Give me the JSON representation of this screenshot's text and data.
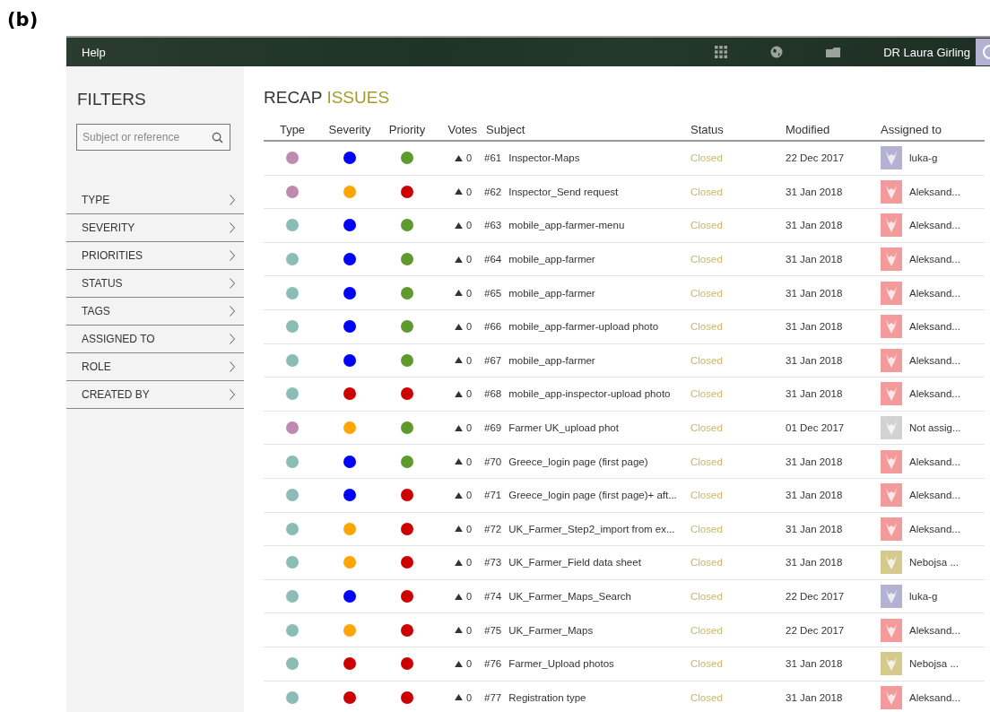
{
  "figure_label": "(b)",
  "topbar": {
    "help": "Help",
    "user": "DR Laura Girling"
  },
  "filters": {
    "title": "FILTERS",
    "search": {
      "placeholder": "Subject or reference"
    },
    "items": [
      "TYPE",
      "SEVERITY",
      "PRIORITIES",
      "STATUS",
      "TAGS",
      "ASSIGNED TO",
      "ROLE",
      "CREATED BY"
    ]
  },
  "page_title": {
    "first": "RECAP",
    "second": "ISSUES"
  },
  "table": {
    "columns": [
      "Type",
      "Severity",
      "Priority",
      "Votes",
      "Subject",
      "Status",
      "Modified",
      "Assigned to"
    ],
    "rows": [
      {
        "type": {
          "color": "#bf8aaf"
        },
        "severity": {
          "color": "#0000ff"
        },
        "priority": {
          "color": "#5f9a2f"
        },
        "votes": "0",
        "ref": "#61",
        "subject": "Inspector-Maps",
        "status": "Closed",
        "modified": "22 Dec 2017",
        "assignee": {
          "name": "luka-g",
          "color": "#b4b1d2"
        }
      },
      {
        "type": {
          "color": "#bf8aaf"
        },
        "severity": {
          "color": "#ffa500"
        },
        "priority": {
          "color": "#cc0000"
        },
        "votes": "0",
        "ref": "#62",
        "subject": "Inspector_Send request",
        "status": "Closed",
        "modified": "31 Jan 2018",
        "assignee": {
          "name": "Aleksand...",
          "color": "#f39b9b"
        }
      },
      {
        "type": {
          "color": "#8bbcb5"
        },
        "severity": {
          "color": "#0000ff"
        },
        "priority": {
          "color": "#5f9a2f"
        },
        "votes": "0",
        "ref": "#63",
        "subject": "mobile_app-farmer-menu",
        "status": "Closed",
        "modified": "31 Jan 2018",
        "assignee": {
          "name": "Aleksand...",
          "color": "#f39b9b"
        }
      },
      {
        "type": {
          "color": "#8bbcb5"
        },
        "severity": {
          "color": "#0000ff"
        },
        "priority": {
          "color": "#5f9a2f"
        },
        "votes": "0",
        "ref": "#64",
        "subject": "mobile_app-farmer",
        "status": "Closed",
        "modified": "31 Jan 2018",
        "assignee": {
          "name": "Aleksand...",
          "color": "#f39b9b"
        }
      },
      {
        "type": {
          "color": "#8bbcb5"
        },
        "severity": {
          "color": "#0000ff"
        },
        "priority": {
          "color": "#5f9a2f"
        },
        "votes": "0",
        "ref": "#65",
        "subject": "mobile_app-farmer",
        "status": "Closed",
        "modified": "31 Jan 2018",
        "assignee": {
          "name": "Aleksand...",
          "color": "#f39b9b"
        }
      },
      {
        "type": {
          "color": "#8bbcb5"
        },
        "severity": {
          "color": "#0000ff"
        },
        "priority": {
          "color": "#5f9a2f"
        },
        "votes": "0",
        "ref": "#66",
        "subject": "mobile_app-farmer-upload photo",
        "status": "Closed",
        "modified": "31 Jan 2018",
        "assignee": {
          "name": "Aleksand...",
          "color": "#f39b9b"
        }
      },
      {
        "type": {
          "color": "#8bbcb5"
        },
        "severity": {
          "color": "#0000ff"
        },
        "priority": {
          "color": "#5f9a2f"
        },
        "votes": "0",
        "ref": "#67",
        "subject": "mobile_app-farmer",
        "status": "Closed",
        "modified": "31 Jan 2018",
        "assignee": {
          "name": "Aleksand...",
          "color": "#f39b9b"
        }
      },
      {
        "type": {
          "color": "#8bbcb5"
        },
        "severity": {
          "color": "#cc0000"
        },
        "priority": {
          "color": "#cc0000"
        },
        "votes": "0",
        "ref": "#68",
        "subject": "mobile_app-inspector-upload photo",
        "status": "Closed",
        "modified": "31 Jan 2018",
        "assignee": {
          "name": "Aleksand...",
          "color": "#f39b9b"
        }
      },
      {
        "type": {
          "color": "#bf8aaf"
        },
        "severity": {
          "color": "#ffa500"
        },
        "priority": {
          "color": "#5f9a2f"
        },
        "votes": "0",
        "ref": "#69",
        "subject": "Farmer UK_upload phot",
        "status": "Closed",
        "modified": "01 Dec 2017",
        "assignee": {
          "name": "Not assig...",
          "color": "#d2d2d2"
        }
      },
      {
        "type": {
          "color": "#8bbcb5"
        },
        "severity": {
          "color": "#0000ff"
        },
        "priority": {
          "color": "#5f9a2f"
        },
        "votes": "0",
        "ref": "#70",
        "subject": "Greece_login page (first page)",
        "status": "Closed",
        "modified": "31 Jan 2018",
        "assignee": {
          "name": "Aleksand...",
          "color": "#f39b9b"
        }
      },
      {
        "type": {
          "color": "#8bbcb5"
        },
        "severity": {
          "color": "#0000ff"
        },
        "priority": {
          "color": "#cc0000"
        },
        "votes": "0",
        "ref": "#71",
        "subject": "Greece_login page (first page)+ aft...",
        "status": "Closed",
        "modified": "31 Jan 2018",
        "assignee": {
          "name": "Aleksand...",
          "color": "#f39b9b"
        }
      },
      {
        "type": {
          "color": "#8bbcb5"
        },
        "severity": {
          "color": "#ffa500"
        },
        "priority": {
          "color": "#cc0000"
        },
        "votes": "0",
        "ref": "#72",
        "subject": "UK_Farmer_Step2_import from ex...",
        "status": "Closed",
        "modified": "31 Jan 2018",
        "assignee": {
          "name": "Aleksand...",
          "color": "#f39b9b"
        }
      },
      {
        "type": {
          "color": "#8bbcb5"
        },
        "severity": {
          "color": "#ffa500"
        },
        "priority": {
          "color": "#cc0000"
        },
        "votes": "0",
        "ref": "#73",
        "subject": "UK_Farmer_Field data sheet",
        "status": "Closed",
        "modified": "31 Jan 2018",
        "assignee": {
          "name": "Nebojsa ...",
          "color": "#d6c98e"
        }
      },
      {
        "type": {
          "color": "#8bbcb5"
        },
        "severity": {
          "color": "#0000ff"
        },
        "priority": {
          "color": "#cc0000"
        },
        "votes": "0",
        "ref": "#74",
        "subject": "UK_Farmer_Maps_Search",
        "status": "Closed",
        "modified": "22 Dec 2017",
        "assignee": {
          "name": "luka-g",
          "color": "#b4b1d2"
        }
      },
      {
        "type": {
          "color": "#8bbcb5"
        },
        "severity": {
          "color": "#ffa500"
        },
        "priority": {
          "color": "#cc0000"
        },
        "votes": "0",
        "ref": "#75",
        "subject": "UK_Farmer_Maps",
        "status": "Closed",
        "modified": "22 Dec 2017",
        "assignee": {
          "name": "Aleksand...",
          "color": "#f39b9b"
        }
      },
      {
        "type": {
          "color": "#8bbcb5"
        },
        "severity": {
          "color": "#cc0000"
        },
        "priority": {
          "color": "#cc0000"
        },
        "votes": "0",
        "ref": "#76",
        "subject": "Farmer_Upload photos",
        "status": "Closed",
        "modified": "31 Jan 2018",
        "assignee": {
          "name": "Nebojsa ...",
          "color": "#d6c98e"
        }
      },
      {
        "type": {
          "color": "#8bbcb5"
        },
        "severity": {
          "color": "#cc0000"
        },
        "priority": {
          "color": "#cc0000"
        },
        "votes": "0",
        "ref": "#77",
        "subject": "Registration type",
        "status": "Closed",
        "modified": "31 Jan 2018",
        "assignee": {
          "name": "Aleksand...",
          "color": "#f39b9b"
        }
      }
    ]
  }
}
